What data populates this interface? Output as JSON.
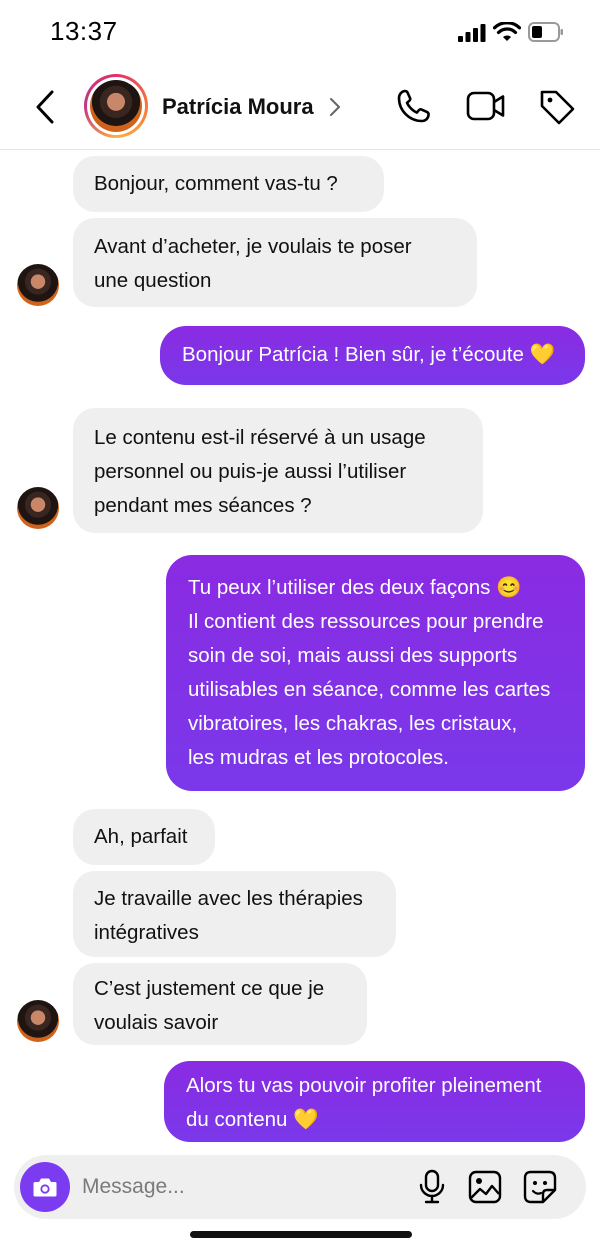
{
  "status_bar": {
    "time": "13:37"
  },
  "header": {
    "contact_name": "Patrícia Moura"
  },
  "messages": [
    {
      "text": "Bonjour, comment vas-tu ?"
    },
    {
      "text": "Avant d’acheter, je voulais te poser\nune question"
    },
    {
      "text": "Bonjour Patrícia ! Bien sûr, je t’écoute",
      "emoji": "💛"
    },
    {
      "text": "Le contenu est-il réservé à un usage\npersonnel ou puis-je aussi l’utiliser\npendant mes séances ?"
    },
    {
      "line1": "Tu peux l’utiliser des deux façons",
      "emoji": "😊",
      "rest": "Il contient des ressources pour prendre\nsoin de soi, mais aussi des supports\nutilisables en séance, comme les cartes\nvibratoires, les chakras, les cristaux,\nles mudras et les protocoles."
    },
    {
      "text": "Ah, parfait"
    },
    {
      "text": "Je travaille avec les thérapies\nintégratives"
    },
    {
      "text": "C’est justement ce que je\nvoulais savoir"
    },
    {
      "text": "Alors tu vas pouvoir profiter pleinement\ndu contenu",
      "emoji": "💛"
    }
  ],
  "composer": {
    "placeholder": "Message..."
  },
  "colors": {
    "accent": "#7b3bf0",
    "incoming_bubble": "#efefef",
    "outgoing_bubble": "#8a2be2"
  },
  "icons": [
    "back-icon",
    "chevron-right-icon",
    "phone-icon",
    "video-camera-icon",
    "tag-icon",
    "camera-icon",
    "microphone-icon",
    "gallery-icon",
    "sticker-icon"
  ]
}
